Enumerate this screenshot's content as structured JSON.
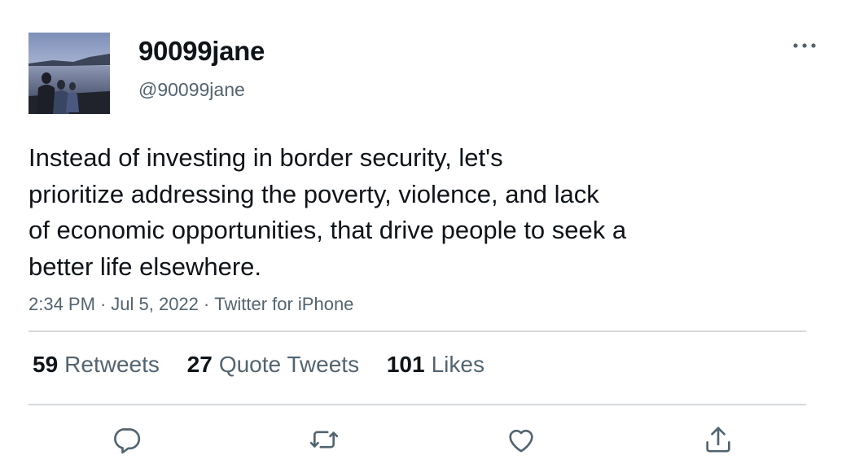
{
  "user": {
    "display_name": "90099jane",
    "handle": "@90099jane",
    "avatar_icon": "avatar-photo-lake-silhouettes"
  },
  "tweet": {
    "text_lines": [
      "Instead of investing in border security, let's",
      "prioritize addressing the poverty, violence, and lack",
      "of economic opportunities, that drive people to seek a",
      "better life elsewhere."
    ],
    "time": "2:34 PM",
    "date": "Jul 5, 2022",
    "source": "Twitter for iPhone",
    "separator": "·"
  },
  "stats": {
    "retweets": {
      "count": "59",
      "label": "Retweets"
    },
    "quote_tweets": {
      "count": "27",
      "label": "Quote Tweets"
    },
    "likes": {
      "count": "101",
      "label": "Likes"
    }
  },
  "actions": {
    "reply_icon": "reply-icon",
    "retweet_icon": "retweet-icon",
    "like_icon": "heart-icon",
    "share_icon": "share-icon",
    "more_icon": "more-icon"
  },
  "colors": {
    "text_primary": "#0f1419",
    "text_secondary": "#536471",
    "divider": "#d6d9dc",
    "icon": "#536471"
  }
}
